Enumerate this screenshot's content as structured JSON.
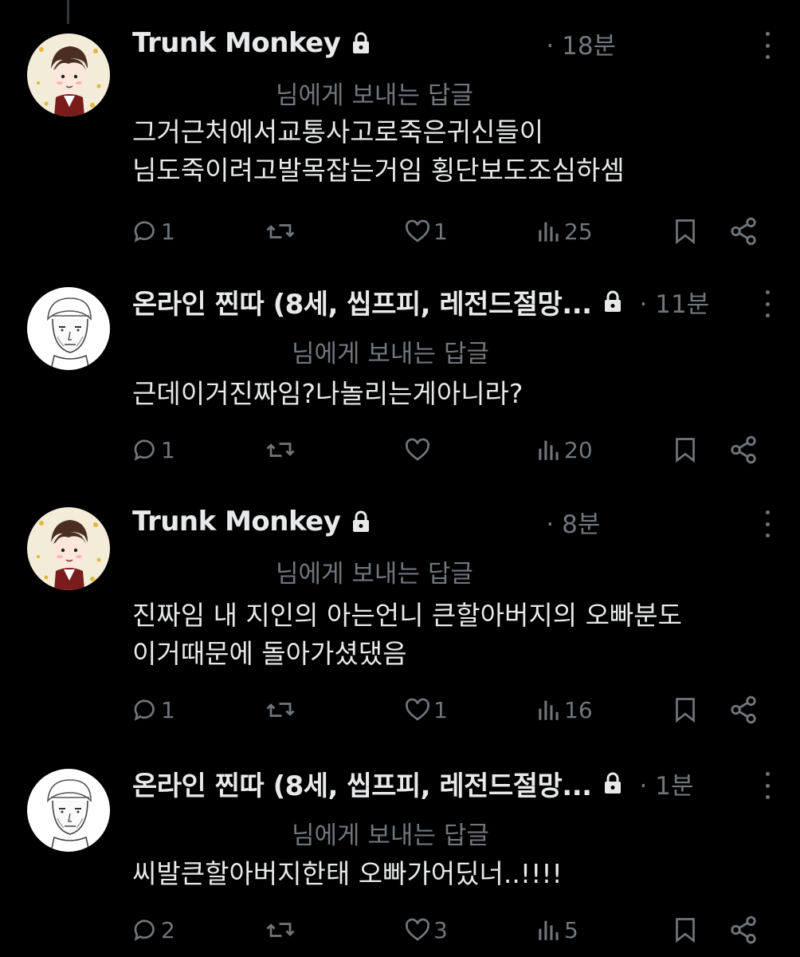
{
  "replying_label": "님에게 보내는 답글",
  "tweets": [
    {
      "name": "Trunk Monkey",
      "time": "· 18분",
      "body_lines": [
        "그거근처에서교통사고로죽은귀신들이",
        "님도죽이려고발목잡는거임 횡단보도조심하셈"
      ],
      "replies": "1",
      "retweets": "",
      "likes": "1",
      "views": "25"
    },
    {
      "name": "온라인 찐따 (8세, 씹프피, 레전드절망...",
      "time": "· 11분",
      "body_lines": [
        "근데이거진짜임?나놀리는게아니라?"
      ],
      "replies": "1",
      "retweets": "",
      "likes": "",
      "views": "20"
    },
    {
      "name": "Trunk Monkey",
      "time": "· 8분",
      "body_lines": [
        "진짜임 내 지인의 아는언니 큰할아버지의 오빠분도",
        "이거때문에 돌아가셨댔음"
      ],
      "replies": "1",
      "retweets": "",
      "likes": "1",
      "views": "16"
    },
    {
      "name": "온라인 찐따 (8세, 씹프피, 레전드절망...",
      "time": "· 1분",
      "body_lines": [
        "씨발큰할아버지한태 오빠가어딨너..!!!!"
      ],
      "replies": "2",
      "retweets": "",
      "likes": "3",
      "views": "5"
    }
  ],
  "icons": {
    "reply": "speech-bubble-icon",
    "retweet": "retweet-arrows-icon",
    "like": "heart-icon",
    "views": "bar-chart-icon",
    "bookmark": "bookmark-icon",
    "share": "share-nodes-icon",
    "lock": "lock-icon",
    "more": "vertical-ellipsis-icon"
  },
  "colors": {
    "background": "#000000",
    "text": "#e7e9ea",
    "muted": "#71767b"
  }
}
